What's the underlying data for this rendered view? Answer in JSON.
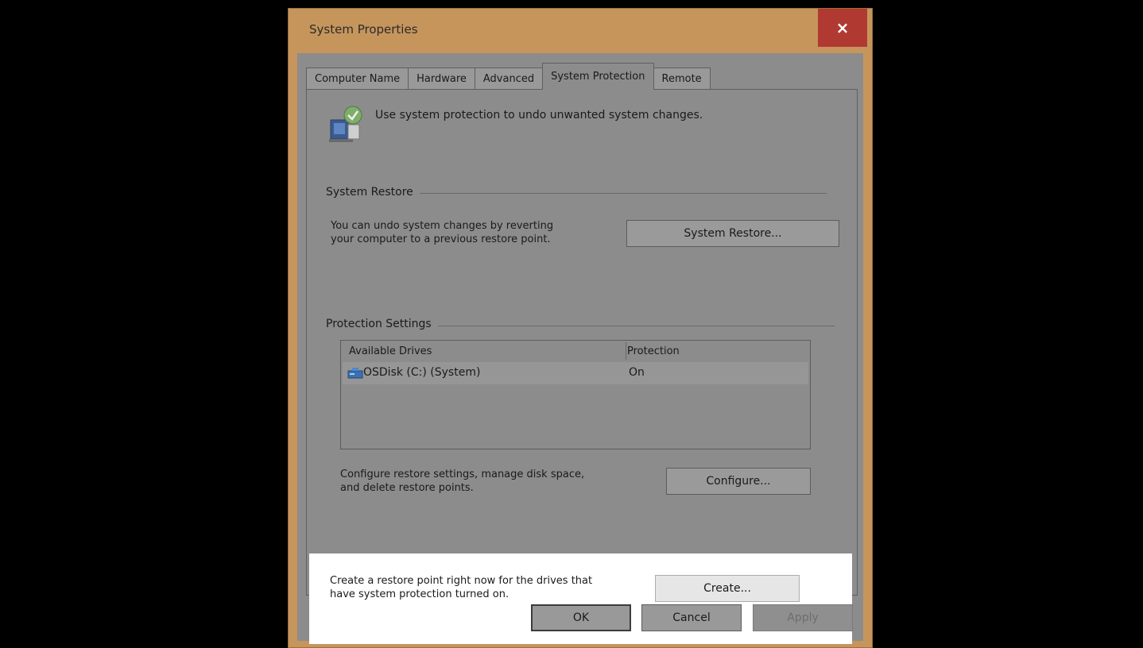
{
  "window": {
    "title": "System Properties",
    "close_label": "×"
  },
  "tabs": [
    {
      "label": "Computer Name",
      "active": false
    },
    {
      "label": "Hardware",
      "active": false
    },
    {
      "label": "Advanced",
      "active": false
    },
    {
      "label": "System Protection",
      "active": true
    },
    {
      "label": "Remote",
      "active": false
    }
  ],
  "intro": {
    "text": "Use system protection to undo unwanted system changes.",
    "icon": "system-protection-icon"
  },
  "system_restore": {
    "group_label": "System Restore",
    "description_line1": "You can undo system changes by reverting",
    "description_line2": "your computer to a previous restore point.",
    "button_label": "System Restore..."
  },
  "protection_settings": {
    "group_label": "Protection Settings",
    "columns": [
      "Available Drives",
      "Protection"
    ],
    "rows": [
      {
        "drive": "OSDisk (C:) (System)",
        "protection": "On",
        "icon": "drive-icon"
      }
    ],
    "configure_desc_line1": "Configure restore settings, manage disk space,",
    "configure_desc_line2": "and delete restore points.",
    "configure_label": "Configure...",
    "create_desc_line1": "Create a restore point right now for the drives that",
    "create_desc_line2": "have system protection turned on.",
    "create_label": "Create..."
  },
  "footer": {
    "ok_label": "OK",
    "cancel_label": "Cancel",
    "apply_label": "Apply"
  },
  "colors": {
    "frame": "#c6955c",
    "close_button": "#b03a32",
    "dimmed_background": "#8c8c8c",
    "highlight": "#ffffff"
  }
}
